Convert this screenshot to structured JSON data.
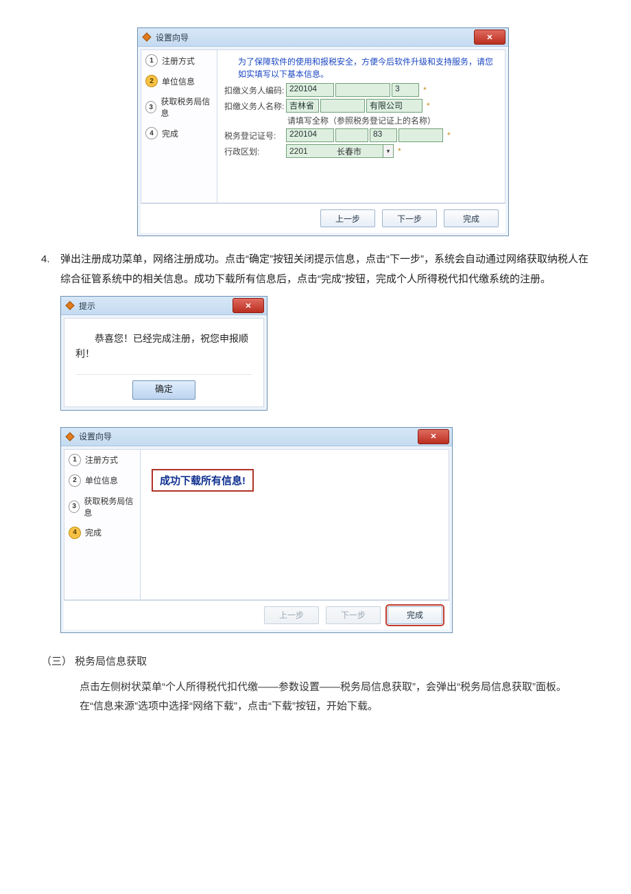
{
  "wizard1": {
    "title": "设置向导",
    "close_label": "✕",
    "steps": [
      {
        "num": "1",
        "label": "注册方式"
      },
      {
        "num": "2",
        "label": "单位信息"
      },
      {
        "num": "3",
        "label": "获取税务局信息"
      },
      {
        "num": "4",
        "label": "完成"
      }
    ],
    "active_step_index": 1,
    "intro": "为了保障软件的使用和报税安全，方便今后软件升级和支持服务，请您如实填写以下基本信息。",
    "fields": {
      "withholder_code_label": "扣缴义务人编码:",
      "withholder_code_a": "220104",
      "withholder_code_b": "3",
      "withholder_name_label": "扣缴义务人名称:",
      "withholder_name_a": "吉林省",
      "withholder_name_b": "有限公司",
      "withholder_name_hint": "请填写全称（参照税务登记证上的名称）",
      "tax_reg_label": "税务登记证号:",
      "tax_reg_a": "220104",
      "tax_reg_b": "83",
      "district_label": "行政区划:",
      "district_code": "2201",
      "district_name": "长春市"
    },
    "buttons": {
      "prev": "上一步",
      "next": "下一步",
      "finish": "完成"
    }
  },
  "doc": {
    "item4_num": "4.",
    "item4_text": "弹出注册成功菜单，网络注册成功。点击“确定”按钮关闭提示信息，点击“下一步”，系统会自动通过网络获取纳税人在综合征管系统中的相关信息。成功下载所有信息后，点击“完成”按钮，完成个人所得税代扣代缴系统的注册。",
    "section3_heading": "（三）  税务局信息获取",
    "section3_para": "点击左侧树状菜单“个人所得税代扣代缴——参数设置——税务局信息获取”，会弹出“税务局信息获取”面板。在“信息来源”选项中选择“网络下载”，点击“下载”按钮，开始下载。"
  },
  "prompt": {
    "title": "提示",
    "close_label": "✕",
    "message_line1": "恭喜您！已经完成注册，祝您申报顺",
    "message_line2": "利！",
    "ok": "确定"
  },
  "wizard2": {
    "title": "设置向导",
    "close_label": "✕",
    "steps": [
      {
        "num": "1",
        "label": "注册方式"
      },
      {
        "num": "2",
        "label": "单位信息"
      },
      {
        "num": "3",
        "label": "获取税务局信息"
      },
      {
        "num": "4",
        "label": "完成"
      }
    ],
    "active_step_index": 3,
    "success_text": "成功下载所有信息!",
    "buttons": {
      "prev": "上一步",
      "next": "下一步",
      "finish": "完成"
    }
  }
}
